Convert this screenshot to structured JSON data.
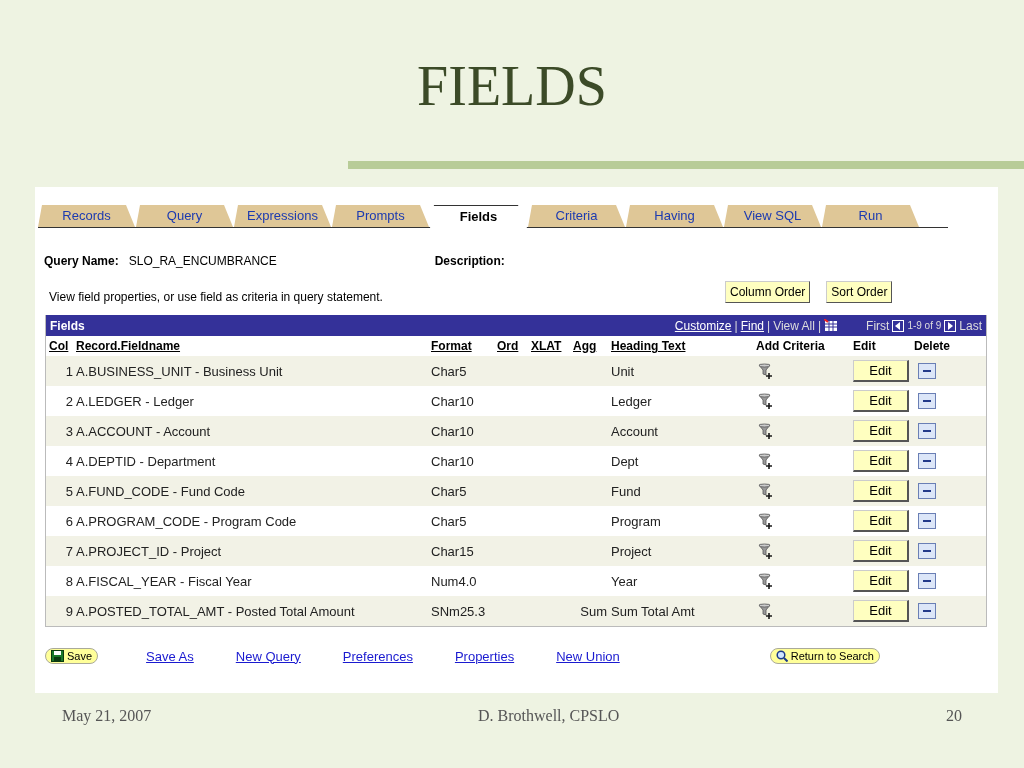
{
  "slide": {
    "title": "FIELDS"
  },
  "tabs": [
    {
      "label": "Records",
      "selected": false
    },
    {
      "label": "Query",
      "selected": false
    },
    {
      "label": "Expressions",
      "selected": false
    },
    {
      "label": "Prompts",
      "selected": false
    },
    {
      "label": "Fields",
      "selected": true
    },
    {
      "label": "Criteria",
      "selected": false
    },
    {
      "label": "Having",
      "selected": false
    },
    {
      "label": "View SQL",
      "selected": false
    },
    {
      "label": "Run",
      "selected": false
    }
  ],
  "query_name": {
    "label": "Query Name:",
    "value": "SLO_RA_ENCUMBRANCE"
  },
  "description": {
    "label": "Description:"
  },
  "instructions": "View field properties, or use field as criteria in query statement.",
  "buttons": [
    "Column Order",
    "Sort Order"
  ],
  "grid": {
    "title": "Fields",
    "links": [
      "Customize",
      "Find"
    ],
    "separators": [
      "|",
      "|",
      "|"
    ],
    "view_all": "View All",
    "first": "First",
    "range": "1-9 of 9",
    "last": "Last",
    "columns": [
      {
        "label": "Col",
        "sortable": true
      },
      {
        "label": "Record.Fieldname",
        "sortable": true
      },
      {
        "label": "Format",
        "sortable": true
      },
      {
        "label": "Ord",
        "sortable": true
      },
      {
        "label": "XLAT",
        "sortable": true
      },
      {
        "label": "Agg",
        "sortable": true
      },
      {
        "label": "Heading Text",
        "sortable": true
      },
      {
        "label": "Add Criteria",
        "sortable": false
      },
      {
        "label": "Edit",
        "sortable": false
      },
      {
        "label": "Delete",
        "sortable": false
      }
    ],
    "rows": [
      {
        "col": "1",
        "fieldname": "A.BUSINESS_UNIT - Business Unit",
        "format": "Char5",
        "heading": "Unit",
        "edit": "Edit"
      },
      {
        "col": "2",
        "fieldname": "A.LEDGER - Ledger",
        "format": "Char10",
        "heading": "Ledger",
        "edit": "Edit"
      },
      {
        "col": "3",
        "fieldname": "A.ACCOUNT - Account",
        "format": "Char10",
        "heading": "Account",
        "edit": "Edit"
      },
      {
        "col": "4",
        "fieldname": "A.DEPTID - Department",
        "format": "Char10",
        "heading": "Dept",
        "edit": "Edit"
      },
      {
        "col": "5",
        "fieldname": "A.FUND_CODE - Fund Code",
        "format": "Char5",
        "heading": "Fund",
        "edit": "Edit"
      },
      {
        "col": "6",
        "fieldname": "A.PROGRAM_CODE - Program Code",
        "format": "Char5",
        "heading": "Program",
        "edit": "Edit"
      },
      {
        "col": "7",
        "fieldname": "A.PROJECT_ID - Project",
        "format": "Char15",
        "heading": "Project",
        "edit": "Edit"
      },
      {
        "col": "8",
        "fieldname": "A.FISCAL_YEAR - Fiscal Year",
        "format": "Num4.0",
        "heading": "Year",
        "edit": "Edit"
      },
      {
        "col": "9",
        "fieldname": "A.POSTED_TOTAL_AMT - Posted Total Amount",
        "format": "SNm25.3",
        "agg": "Sum",
        "heading": "Sum Total Amt",
        "edit": "Edit"
      }
    ]
  },
  "actions": {
    "save": "Save",
    "links": [
      "Save As",
      "New Query",
      "Preferences",
      "Properties",
      "New Union"
    ],
    "return": "Return to Search"
  },
  "footer": {
    "date": "May 21, 2007",
    "author": "D. Brothwell, CPSLO",
    "page": "20"
  }
}
